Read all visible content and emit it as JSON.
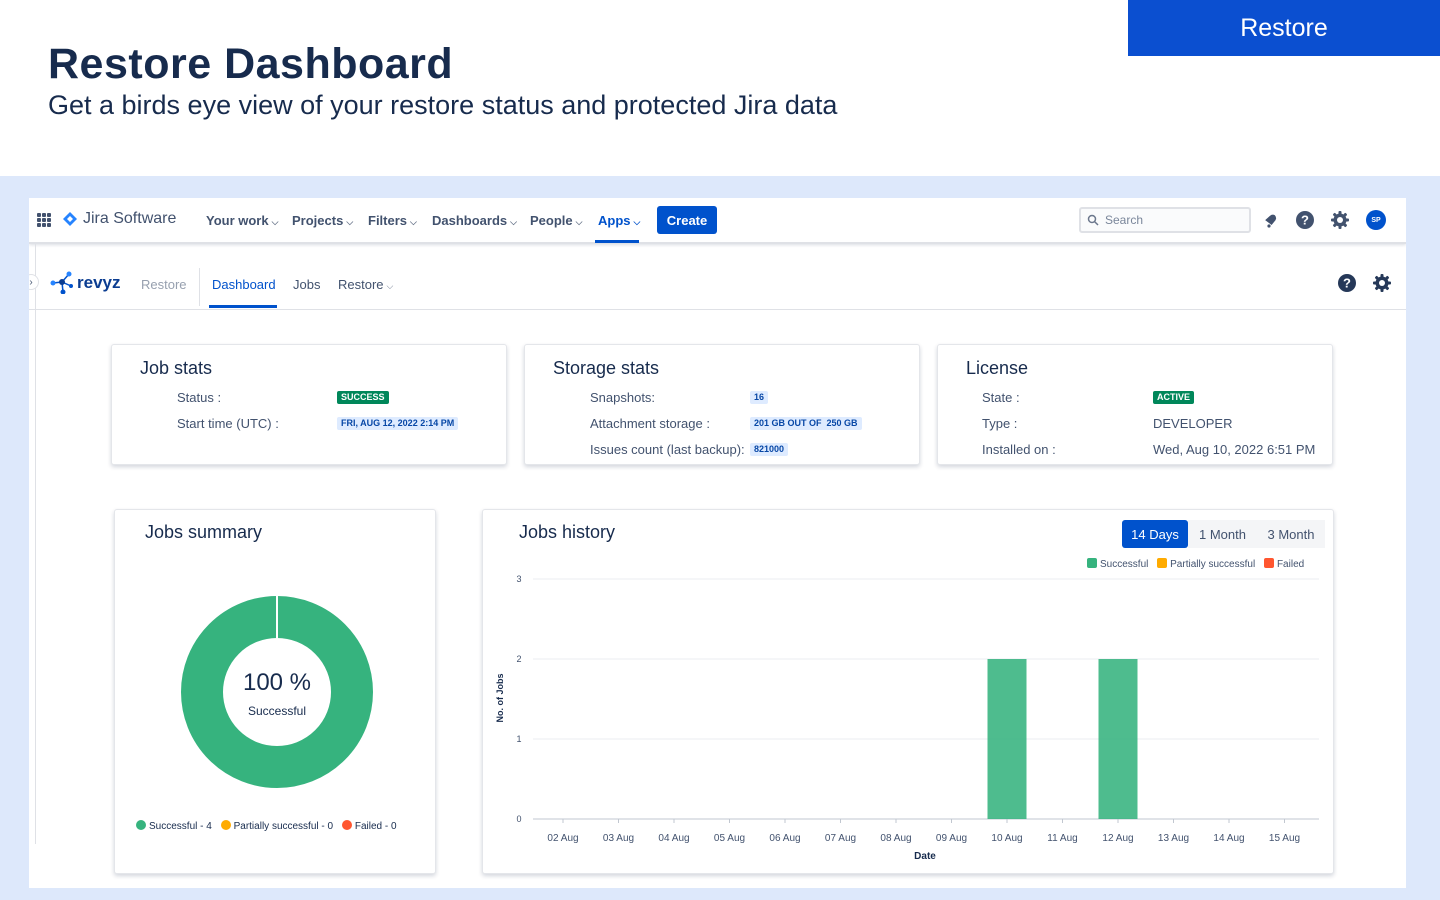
{
  "hero": {
    "title": "Restore Dashboard",
    "subtitle": "Get a birds eye view of your restore status and protected Jira data",
    "badge": "Restore"
  },
  "topnav": {
    "product_name": "Jira Software",
    "items": [
      {
        "label": "Your work"
      },
      {
        "label": "Projects"
      },
      {
        "label": "Filters"
      },
      {
        "label": "Dashboards"
      },
      {
        "label": "People"
      },
      {
        "label": "Apps"
      }
    ],
    "create_label": "Create",
    "search_placeholder": "Search",
    "avatar_initials": "SP"
  },
  "subnav": {
    "brand": "revyz",
    "tabs": [
      {
        "label": "Restore"
      },
      {
        "label": "Dashboard"
      },
      {
        "label": "Jobs"
      },
      {
        "label": "Restore"
      }
    ]
  },
  "job_stats": {
    "title": "Job stats",
    "status_label": "Status :",
    "status_value": "SUCCESS",
    "start_label": "Start time (UTC) :",
    "start_value": "FRI, AUG 12, 2022 2:14 PM"
  },
  "storage_stats": {
    "title": "Storage stats",
    "snapshots_label": "Snapshots:",
    "snapshots_value": "16",
    "attachment_label": "Attachment storage :",
    "attachment_value": "201 GB OUT OF  250 GB",
    "issues_label": "Issues count (last backup):",
    "issues_value": "821000"
  },
  "license": {
    "title": "License",
    "state_label": "State :",
    "state_value": "ACTIVE",
    "type_label": "Type :",
    "type_value": "DEVELOPER",
    "installed_label": "Installed on :",
    "installed_value": "Wed, Aug 10, 2022 6:51 PM"
  },
  "jobs_summary": {
    "title": "Jobs summary",
    "center_value": "100 %",
    "center_label": "Successful",
    "legend": [
      {
        "label": "Successful - 4",
        "color": "#36B37E"
      },
      {
        "label": "Partially successful - 0",
        "color": "#FFAB00"
      },
      {
        "label": "Failed - 0",
        "color": "#FF5630"
      }
    ]
  },
  "jobs_history": {
    "title": "Jobs history",
    "ranges": [
      {
        "label": "14 Days",
        "active": true
      },
      {
        "label": "1 Month",
        "active": false
      },
      {
        "label": "3 Month",
        "active": false
      }
    ]
  },
  "colors": {
    "primary": "#0052CC",
    "success": "#36B37E",
    "partial": "#FFAB00",
    "failed": "#FF5630"
  },
  "chart_data": [
    {
      "type": "pie",
      "categories": [
        "Successful",
        "Partially successful",
        "Failed"
      ],
      "values": [
        4,
        0,
        0
      ],
      "title": "Jobs summary"
    },
    {
      "type": "bar",
      "title": "Jobs history",
      "xlabel": "Date",
      "ylabel": "No. of Jobs",
      "ylim": [
        0,
        3
      ],
      "yticks": [
        0,
        1,
        2,
        3
      ],
      "grid": true,
      "legend_position": "top-right",
      "categories": [
        "02 Aug",
        "03 Aug",
        "04 Aug",
        "05 Aug",
        "06 Aug",
        "07 Aug",
        "08 Aug",
        "09 Aug",
        "10 Aug",
        "11 Aug",
        "12 Aug",
        "13 Aug",
        "14 Aug",
        "15 Aug"
      ],
      "series": [
        {
          "name": "Successful",
          "color": "#36B37E",
          "values": [
            0,
            0,
            0,
            0,
            0,
            0,
            0,
            0,
            2,
            0,
            2,
            0,
            0,
            0
          ]
        },
        {
          "name": "Partially successful",
          "color": "#FFAB00",
          "values": [
            0,
            0,
            0,
            0,
            0,
            0,
            0,
            0,
            0,
            0,
            0,
            0,
            0,
            0
          ]
        },
        {
          "name": "Failed",
          "color": "#FF5630",
          "values": [
            0,
            0,
            0,
            0,
            0,
            0,
            0,
            0,
            0,
            0,
            0,
            0,
            0,
            0
          ]
        }
      ]
    }
  ]
}
